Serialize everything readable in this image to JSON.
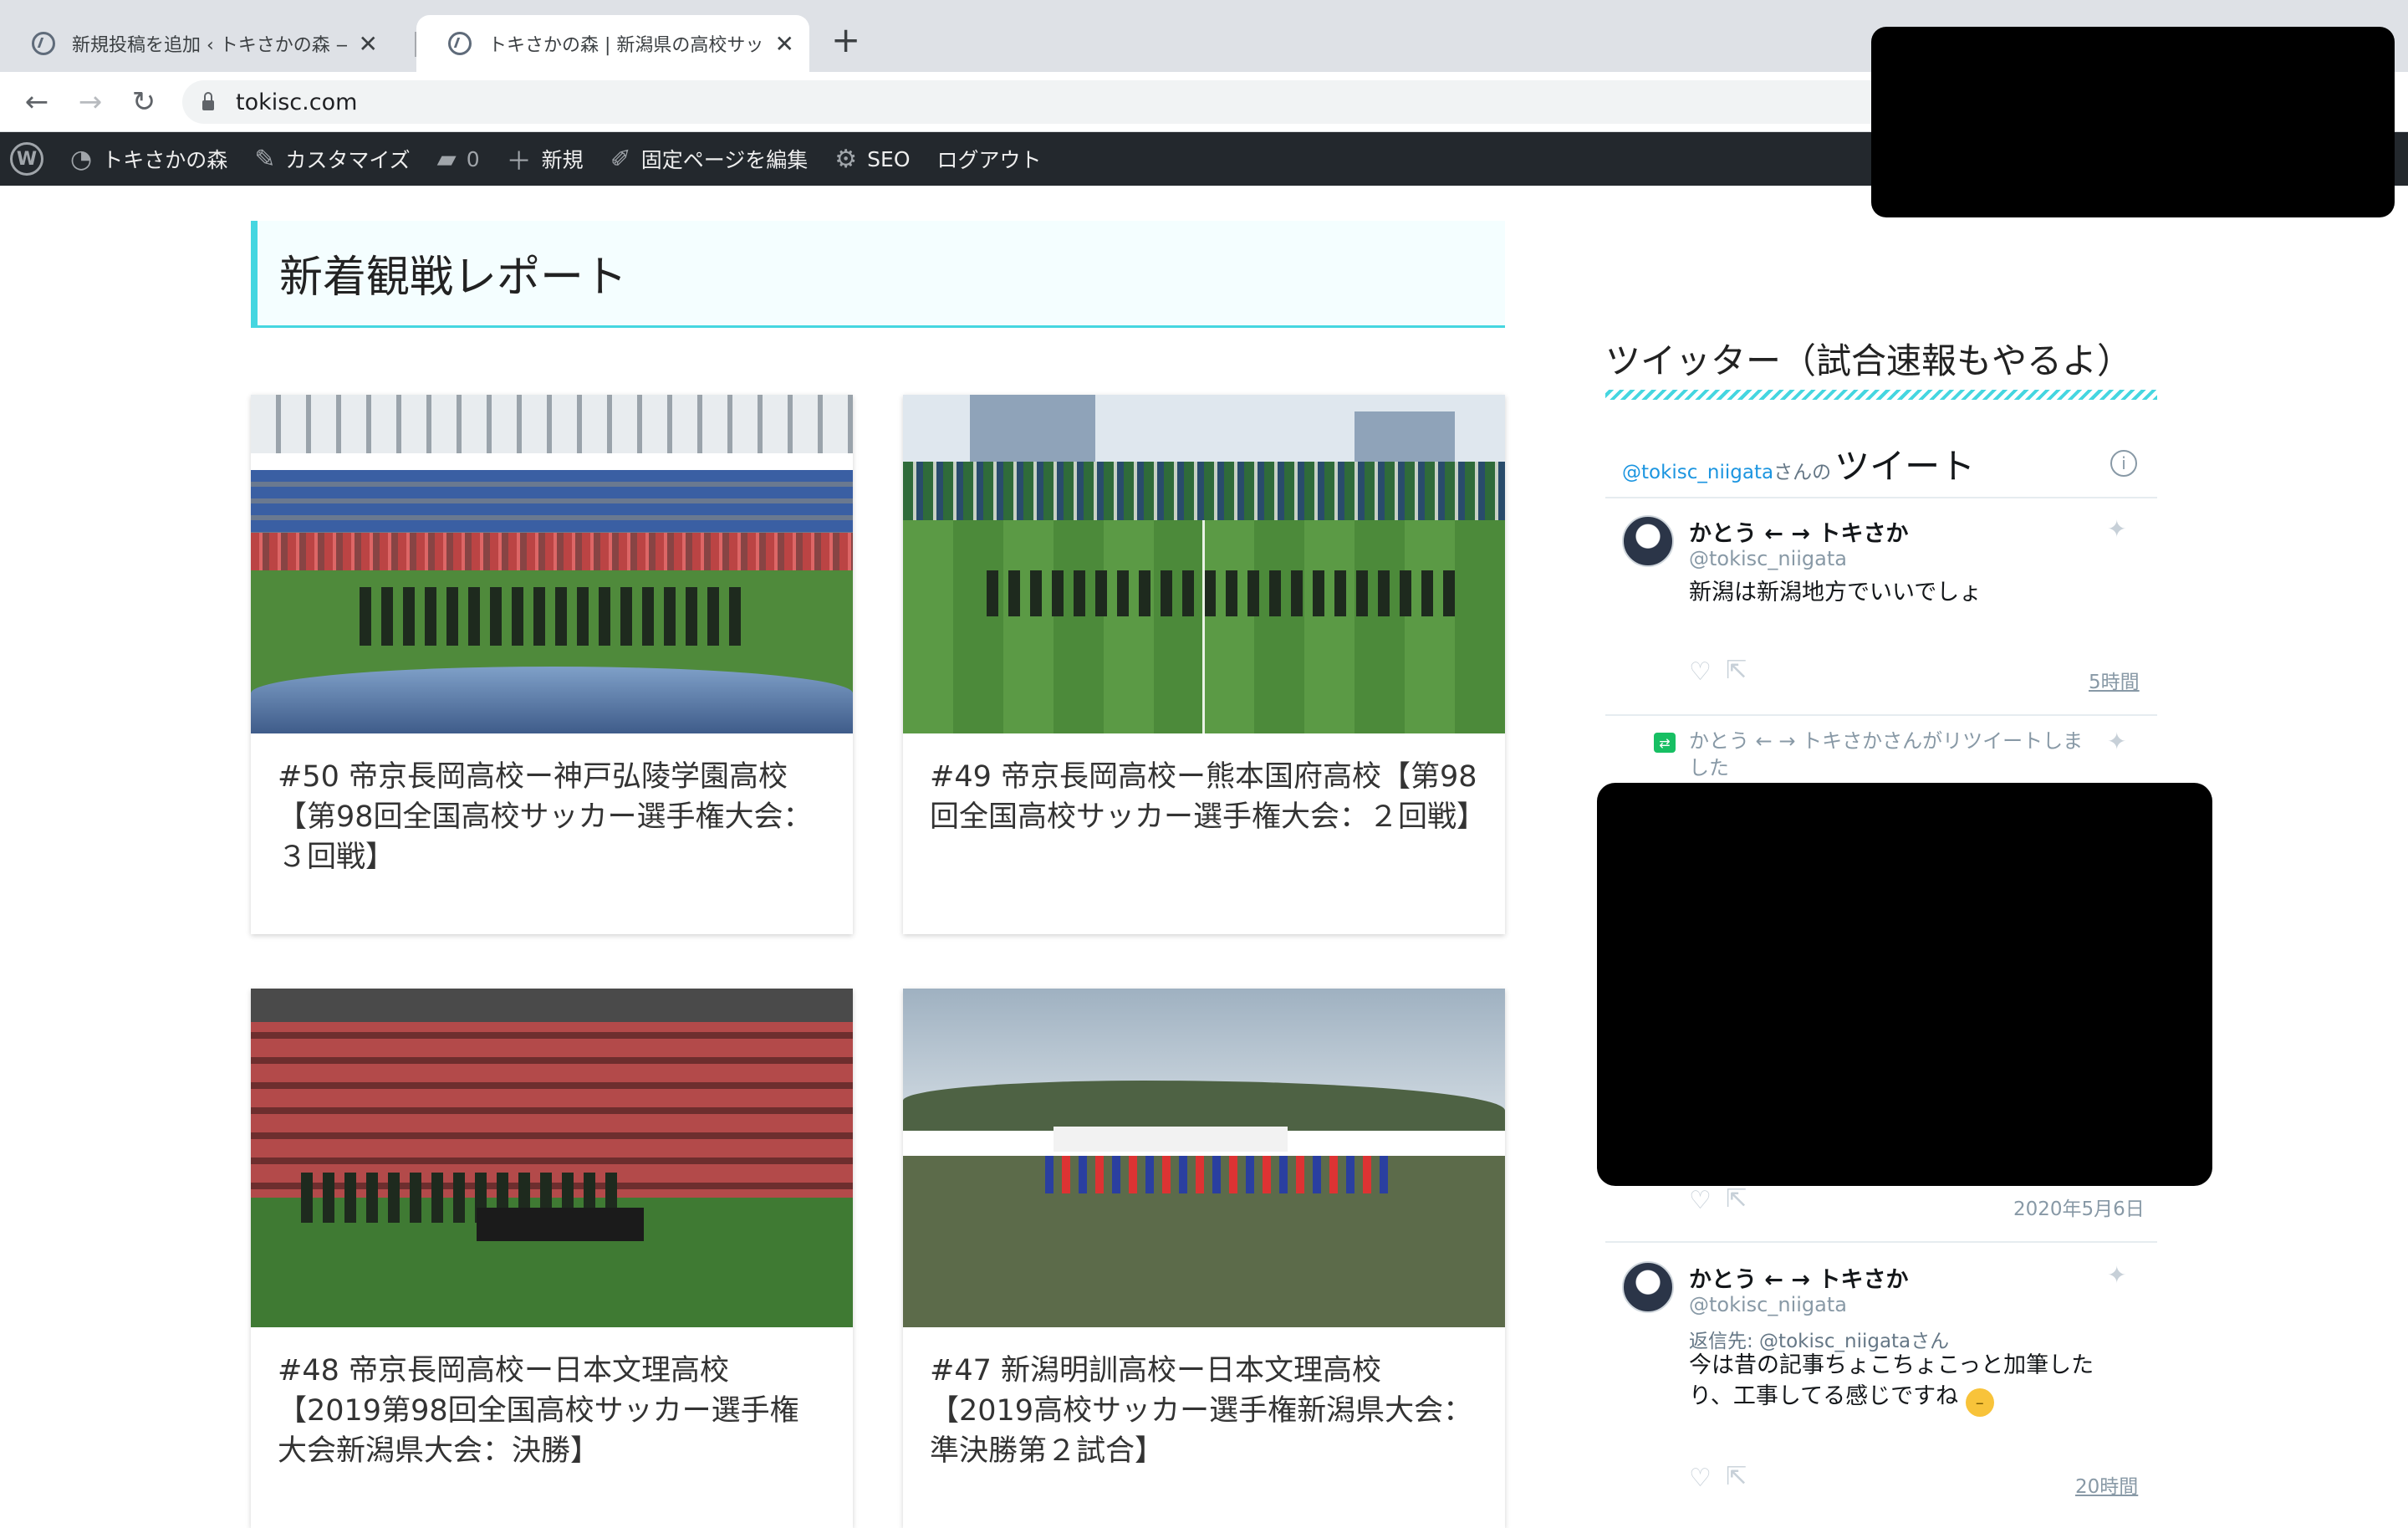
{
  "browser": {
    "tabs": [
      {
        "title": "新規投稿を追加 ‹ トキさかの森 —",
        "active": false
      },
      {
        "title": "トキさかの森 | 新潟県の高校サッカ",
        "active": true
      }
    ],
    "new_tab": "+",
    "url": "tokisc.com"
  },
  "admin_bar": {
    "site_name": "トキさかの森",
    "customize": "カスタマイズ",
    "comments_count": "0",
    "new": "新規",
    "edit_page": "固定ページを編集",
    "seo": "SEO",
    "logout": "ログアウト"
  },
  "main": {
    "section_title": "新着観戦レポート",
    "posts": [
      {
        "title": "#50 帝京長岡高校ー神戸弘陵学園高校【第98回全国高校サッカー選手権大会：３回戦】"
      },
      {
        "title": "#49 帝京長岡高校ー熊本国府高校【第98回全国高校サッカー選手権大会：２回戦】"
      },
      {
        "title": "#48 帝京長岡高校ー日本文理高校【2019第98回全国高校サッカー選手権大会新潟県大会：決勝】"
      },
      {
        "title": "#47 新潟明訓高校ー日本文理高校【2019高校サッカー選手権新潟県大会：準決勝第２試合】"
      }
    ]
  },
  "sidebar": {
    "title": "ツイッター（試合速報もやるよ）",
    "twitter": {
      "handle": "@tokisc_niigata",
      "san_no": "さんの",
      "tweets_word": "ツイート",
      "info": "i",
      "tweets": [
        {
          "name": "かとう ← → トキさか",
          "at": "@tokisc_niigata",
          "text": "新潟は新潟地方でいいでしょ",
          "time": "5時間"
        },
        {
          "retweet_notice": "かとう ← → トキさかさんがリツイートしました",
          "time": "2020年5月6日"
        },
        {
          "name": "かとう ← → トキさか",
          "at": "@tokisc_niigata",
          "reply_to": "返信先: @tokisc_niigataさん",
          "text": "今は昔の記事ちょこちょこっと加筆したり、工事してる感じですね",
          "time": "20時間"
        }
      ]
    }
  },
  "colors": {
    "accent": "#45d6e0",
    "admin_bar": "#23282d",
    "twitter_blue": "#1b95e0"
  },
  "icons": [
    "wordpress-logo-icon",
    "dashboard-icon",
    "brush-icon",
    "comment-icon",
    "plus-icon",
    "pencil-icon",
    "gear-icon",
    "lock-icon",
    "twitter-bird-icon",
    "heart-icon",
    "share-icon",
    "retweet-icon",
    "info-icon"
  ]
}
